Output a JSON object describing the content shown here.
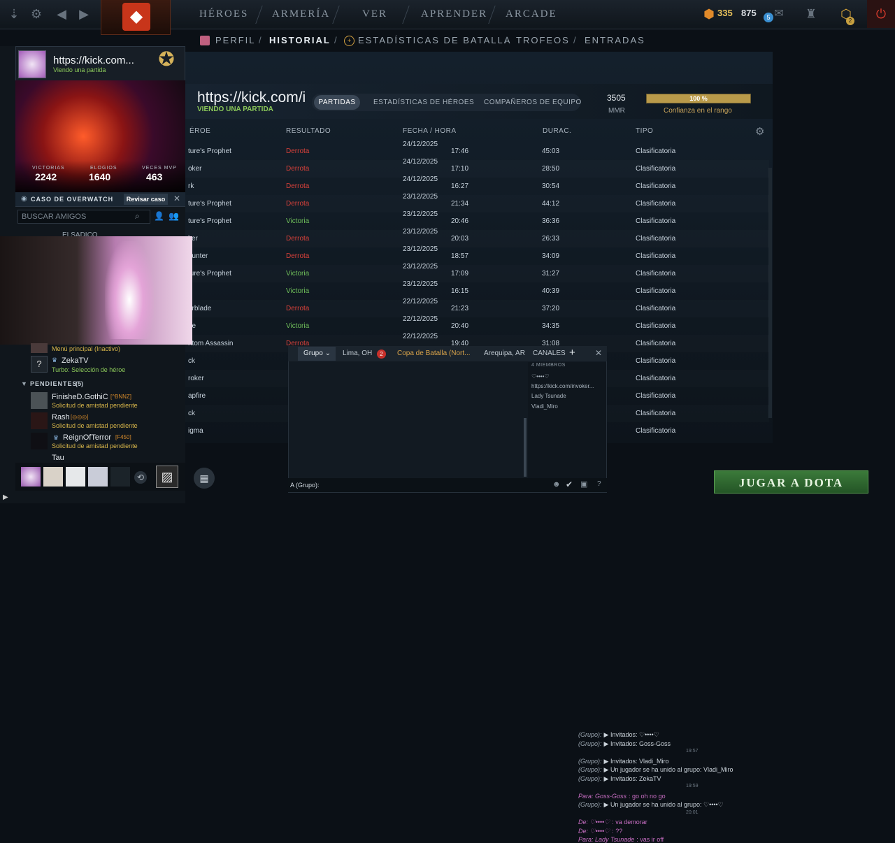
{
  "topnav": {
    "heroes": "HÉROES",
    "armory": "ARMERÍA",
    "watch": "VER",
    "learn": "APRENDER",
    "arcade": "ARCADE",
    "gold": "335",
    "shards": "875",
    "notif_count": "5",
    "badge": "2"
  },
  "subnav": {
    "profile": "PERFIL",
    "history": "HISTORIAL",
    "battle_stats": "ESTADÍSTICAS DE BATALLA",
    "trophies": "TROFEOS",
    "entries": "ENTRADAS",
    "sep": "/"
  },
  "header": {
    "name": "https://kick.com/i",
    "status": "VIENDO UNA PARTIDA",
    "tabs": [
      "PARTIDAS",
      "ESTADÍSTICAS DE HÉROES",
      "COMPAÑEROS DE EQUIPO"
    ],
    "mmr_value": "3505",
    "mmr_label": "MMR",
    "confidence_value": "100 %",
    "confidence_fill": 1.0,
    "confidence_label": "Confianza en el rango"
  },
  "table": {
    "headers": {
      "hero": "ÉROE",
      "result": "RESULTADO",
      "date": "FECHA / HORA",
      "duration": "DURAC.",
      "type": "TIPO"
    },
    "rows": [
      {
        "hero": "ture's Prophet",
        "result": "Derrota",
        "date": "24/12/2025",
        "time": "17:46",
        "duration": "45:03",
        "type": "Clasificatoria"
      },
      {
        "hero": "oker",
        "result": "Derrota",
        "date": "24/12/2025",
        "time": "17:10",
        "duration": "28:50",
        "type": "Clasificatoria"
      },
      {
        "hero": "rk",
        "result": "Derrota",
        "date": "24/12/2025",
        "time": "16:27",
        "duration": "30:54",
        "type": "Clasificatoria"
      },
      {
        "hero": "ture's Prophet",
        "result": "Derrota",
        "date": "23/12/2025",
        "time": "21:34",
        "duration": "44:12",
        "type": "Clasificatoria"
      },
      {
        "hero": "ture's Prophet",
        "result": "Victoria",
        "date": "23/12/2025",
        "time": "20:46",
        "duration": "36:36",
        "type": "Clasificatoria"
      },
      {
        "hero": "ker",
        "result": "Derrota",
        "date": "23/12/2025",
        "time": "20:03",
        "duration": "26:33",
        "type": "Clasificatoria"
      },
      {
        "hero": "hunter",
        "result": "Derrota",
        "date": "23/12/2025",
        "time": "18:57",
        "duration": "34:09",
        "type": "Clasificatoria"
      },
      {
        "hero": "ture's Prophet",
        "result": "Victoria",
        "date": "23/12/2025",
        "time": "17:09",
        "duration": "31:27",
        "type": "Clasificatoria"
      },
      {
        "hero": "",
        "result": "Victoria",
        "date": "23/12/2025",
        "time": "16:15",
        "duration": "40:39",
        "type": "Clasificatoria"
      },
      {
        "hero": "orblade",
        "result": "Derrota",
        "date": "22/12/2025",
        "time": "21:23",
        "duration": "37:20",
        "type": "Clasificatoria"
      },
      {
        "hero": "ge",
        "result": "Victoria",
        "date": "22/12/2025",
        "time": "20:40",
        "duration": "34:35",
        "type": "Clasificatoria"
      },
      {
        "hero": "ntom Assassin",
        "result": "Derrota",
        "date": "22/12/2025",
        "time": "19:40",
        "duration": "31:08",
        "type": "Clasificatoria"
      },
      {
        "hero": "ck",
        "result": "",
        "date": "",
        "time": "",
        "duration": "",
        "type": "Clasificatoria"
      },
      {
        "hero": "roker",
        "result": "",
        "date": "",
        "time": "",
        "duration": "",
        "type": "Clasificatoria"
      },
      {
        "hero": "apfire",
        "result": "",
        "date": "",
        "time": "",
        "duration": "",
        "type": "Clasificatoria"
      },
      {
        "hero": "ck",
        "result": "",
        "date": "",
        "time": "",
        "duration": "",
        "type": "Clasificatoria"
      },
      {
        "hero": "igma",
        "result": "",
        "date": "",
        "time": "",
        "duration": "",
        "type": "Clasificatoria"
      }
    ]
  },
  "friend_card": {
    "name": "https://kick.com...",
    "status": "Viendo una partida",
    "stat1_label": "VICTORIAS",
    "stat1_value": "2242",
    "stat2_label": "ELOGIOS",
    "stat2_value": "1640",
    "stat3_label": "VECES MVP",
    "stat3_value": "463",
    "overwatch_label": "CASO DE OVERWATCH",
    "overwatch_button": "Revisar caso"
  },
  "friends": {
    "search_placeholder": "BUSCAR AMIGOS",
    "partial_name": "ELSADICO",
    "menu_status": "Menú principal (Inactivo)",
    "zeka_name": "ZekaTV",
    "zeka_status": "Turbo: Selección de héroe",
    "pending_header": "PENDIENTES",
    "pending_count": "(5)",
    "pending": [
      {
        "name": "FinisheD.GothiC",
        "tag": "[^BNNZ]",
        "status": "Solicitud de amistad pendiente"
      },
      {
        "name": "Rash",
        "tag": "[◎◎◎]",
        "status": "Solicitud de amistad pendiente"
      },
      {
        "name": "ReignOfTerror",
        "tag": "[F450]",
        "status": "Solicitud de amistad pendiente"
      }
    ],
    "last_name": "Tau"
  },
  "chat": {
    "tabs": [
      "Grupo",
      "Lima, OH",
      "Copa de Batalla (Nort...",
      "Arequipa, AR"
    ],
    "lima_badge": "2",
    "channels_label": "CANALES",
    "members_header": "4 MIEMBROS",
    "members": [
      "♡••••♡",
      "https://kick.com/invoker...",
      "Lady Tsunade",
      "Vladi_Miro"
    ],
    "lines": [
      {
        "prefix": "(Grupo):",
        "text": "▶ Invitados: ♡••••♡"
      },
      {
        "prefix": "(Grupo):",
        "text": "▶ Invitados: Goss-Goss"
      },
      {
        "prefix": "",
        "text": "19:57"
      },
      {
        "prefix": "(Grupo):",
        "text": "▶ Invitados: Vladi_Miro"
      },
      {
        "prefix": "(Grupo):",
        "text": "▶ Un jugador se ha unido al grupo: Vladi_Miro"
      },
      {
        "prefix": "(Grupo):",
        "text": "▶ Invitados: ZekaTV"
      },
      {
        "prefix": "",
        "text": "19:59"
      },
      {
        "prefix": "Para: Goss-Goss",
        "text": ": go oh no go"
      },
      {
        "prefix": "(Grupo):",
        "text": "▶ Un jugador se ha unido al grupo: ♡••••♡"
      },
      {
        "prefix": "",
        "text": "20:01"
      },
      {
        "prefix": "De: ♡••••♡",
        "text": ": va demorar"
      },
      {
        "prefix": "De: ♡••••♡",
        "text": ": ??"
      },
      {
        "prefix": "Para: Lady Tsunade",
        "text": ": vas ir off"
      }
    ],
    "input_label": "A (Grupo):"
  },
  "play_button": "JUGAR A DOTA"
}
